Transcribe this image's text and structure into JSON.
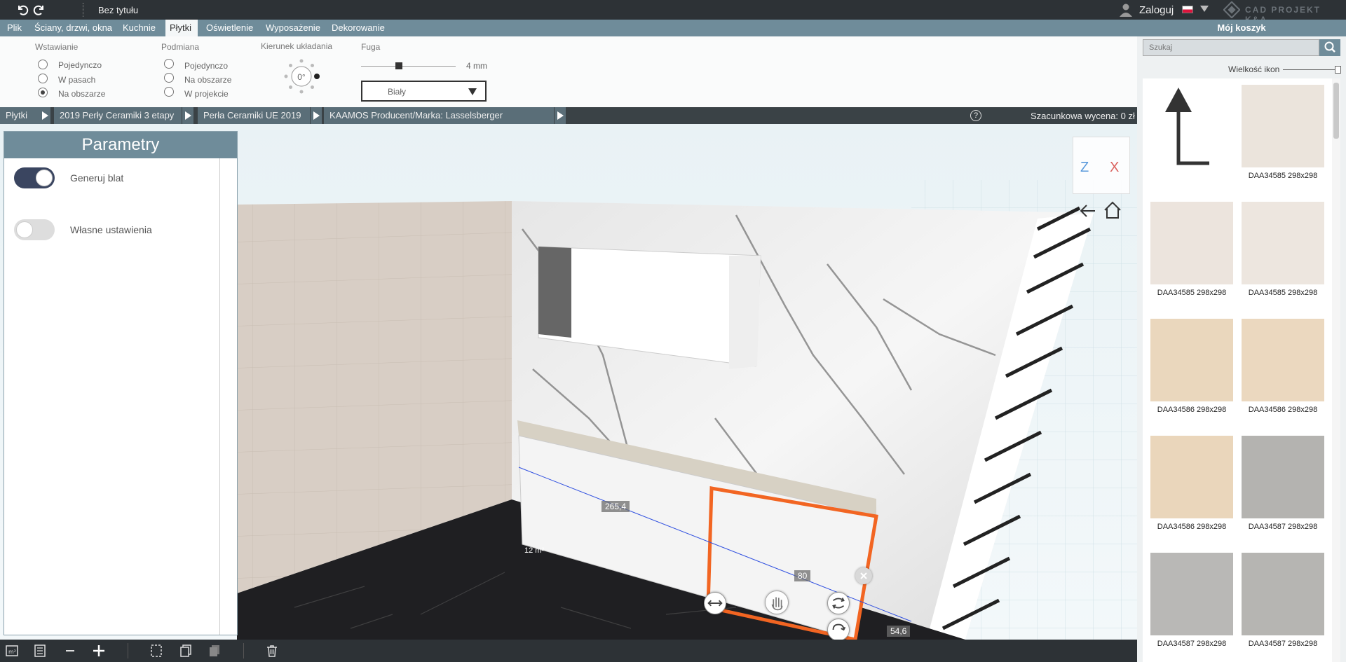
{
  "topbar": {
    "document_title": "Bez tytułu",
    "login": "Zaloguj",
    "brand": "CAD PROJEKT K&A"
  },
  "menu": {
    "items": [
      {
        "label": "Plik"
      },
      {
        "label": "Ściany, drzwi, okna"
      },
      {
        "label": "Kuchnie"
      },
      {
        "label": "Płytki",
        "active": true
      },
      {
        "label": "Oświetlenie"
      },
      {
        "label": "Wyposażenie"
      },
      {
        "label": "Dekorowanie"
      }
    ],
    "cart": "Mój koszyk"
  },
  "ribbon": {
    "insert": {
      "title": "Wstawianie",
      "options": [
        "Pojedynczo",
        "W pasach",
        "Na obszarze"
      ],
      "selected": "Na obszarze"
    },
    "replace": {
      "title": "Podmiana",
      "options": [
        "Pojedynczo",
        "Na obszarze",
        "W projekcie"
      ],
      "selected": ""
    },
    "direction": {
      "title": "Kierunek układania",
      "angle": "0°"
    },
    "grout": {
      "title": "Fuga",
      "width": "4 mm",
      "color": "Biały"
    }
  },
  "breadcrumb": {
    "items": [
      "Płytki",
      "2019 Perły Ceramiki 3 etapy",
      "Perła Ceramiki UE 2019",
      "KAAMOS Producent/Marka: Lasselsberger s.r.o./Rako"
    ],
    "help": "?",
    "estimate": "Szacunkowa wycena: 0 zł"
  },
  "params": {
    "title": "Parametry",
    "generate_top": {
      "label": "Generuj blat",
      "on": true
    },
    "own_settings": {
      "label": "Własne ustawienia",
      "on": false
    }
  },
  "viewcube": {
    "z": "Z",
    "x": "X"
  },
  "dimensions": {
    "length": "265,4",
    "area": "12 m²",
    "width": "80",
    "depth": "54,6"
  },
  "sidebar": {
    "search_placeholder": "Szukaj",
    "icon_size_label": "Wielkość ikon",
    "icon_size_value": 0.95,
    "tiles": [
      {
        "label": "DAA34585 298x298",
        "color": "#ebe4dc"
      },
      {
        "label": "DAA34585 298x298",
        "color": "#ece4dd"
      },
      {
        "label": "DAA34585 298x298",
        "color": "#ede6df"
      },
      {
        "label": "DAA34586 298x298",
        "color": "#ead7bd"
      },
      {
        "label": "DAA34586 298x298",
        "color": "#ebd8bf"
      },
      {
        "label": "DAA34586 298x298",
        "color": "#ead6bb"
      },
      {
        "label": "DAA34587 298x298",
        "color": "#b4b3b0"
      },
      {
        "label": "DAA34587 298x298",
        "color": "#b9b8b6"
      },
      {
        "label": "DAA34587 298x298",
        "color": "#b6b5b2"
      }
    ]
  },
  "colors": {
    "accent": "#6f8c9a",
    "selection": "#f26522",
    "topbar": "#2d3236"
  }
}
